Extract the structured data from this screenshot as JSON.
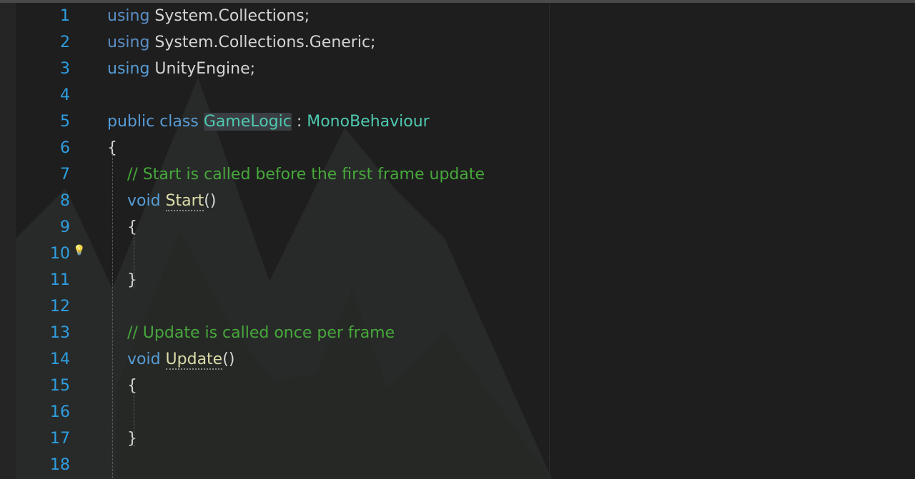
{
  "editor": {
    "lines": [
      {
        "num": "1",
        "tokens": [
          {
            "cls": "kw-using",
            "t": "using"
          },
          {
            "cls": "ns",
            "t": " System.Collections;"
          }
        ]
      },
      {
        "num": "2",
        "tokens": [
          {
            "cls": "kw-using",
            "t": "using"
          },
          {
            "cls": "ns",
            "t": " System.Collections.Generic;"
          }
        ]
      },
      {
        "num": "3",
        "tokens": [
          {
            "cls": "kw",
            "t": "using"
          },
          {
            "cls": "ns",
            "t": " UnityEngine;"
          }
        ]
      },
      {
        "num": "4",
        "tokens": []
      },
      {
        "num": "5",
        "tokens": [
          {
            "cls": "kw",
            "t": "public"
          },
          {
            "cls": "ns",
            "t": " "
          },
          {
            "cls": "kw",
            "t": "class"
          },
          {
            "cls": "ns",
            "t": " "
          },
          {
            "cls": "type hl",
            "t": "GameLogic"
          },
          {
            "cls": "ns",
            "t": " : "
          },
          {
            "cls": "type",
            "t": "MonoBehaviour"
          }
        ]
      },
      {
        "num": "6",
        "tokens": [
          {
            "cls": "ns",
            "t": "{"
          }
        ]
      },
      {
        "num": "7",
        "tokens": [
          {
            "cls": "ns",
            "t": "    "
          },
          {
            "cls": "cmt",
            "t": "// Start is called before the first frame update"
          }
        ]
      },
      {
        "num": "8",
        "tokens": [
          {
            "cls": "ns",
            "t": "    "
          },
          {
            "cls": "kw",
            "t": "void"
          },
          {
            "cls": "ns",
            "t": " "
          },
          {
            "cls": "fn fn-under",
            "t": "Start"
          },
          {
            "cls": "ns",
            "t": "()"
          }
        ]
      },
      {
        "num": "9",
        "tokens": [
          {
            "cls": "ns",
            "t": "    {"
          }
        ]
      },
      {
        "num": "10",
        "tokens": []
      },
      {
        "num": "11",
        "tokens": [
          {
            "cls": "ns",
            "t": "    }"
          }
        ]
      },
      {
        "num": "12",
        "tokens": []
      },
      {
        "num": "13",
        "tokens": [
          {
            "cls": "ns",
            "t": "    "
          },
          {
            "cls": "cmt",
            "t": "// Update is called once per frame"
          }
        ]
      },
      {
        "num": "14",
        "tokens": [
          {
            "cls": "ns",
            "t": "    "
          },
          {
            "cls": "kw",
            "t": "void"
          },
          {
            "cls": "ns",
            "t": " "
          },
          {
            "cls": "fn fn-under",
            "t": "Update"
          },
          {
            "cls": "ns",
            "t": "()"
          }
        ]
      },
      {
        "num": "15",
        "tokens": [
          {
            "cls": "ns",
            "t": "    {"
          }
        ]
      },
      {
        "num": "16",
        "tokens": []
      },
      {
        "num": "17",
        "tokens": [
          {
            "cls": "ns",
            "t": "    }"
          }
        ]
      },
      {
        "num": "18",
        "tokens": []
      }
    ],
    "lightbulb_line": "10",
    "lightbulb_icon": "lightbulb-icon"
  }
}
